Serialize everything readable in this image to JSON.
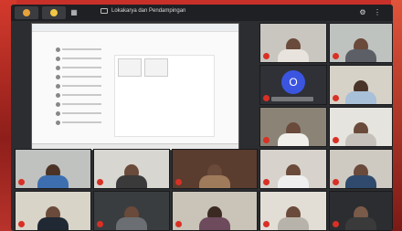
{
  "meeting": {
    "title": "Lokakarya dan Pendampingan",
    "tile_initial": "O"
  },
  "icons": {
    "record": "record-icon",
    "apps": "apps-icon",
    "mic": "mic-off-icon"
  },
  "colors": {
    "mic_muted": "#d93025",
    "avatar_bg": "#3b55e0",
    "window_bg": "#2b2d30"
  }
}
